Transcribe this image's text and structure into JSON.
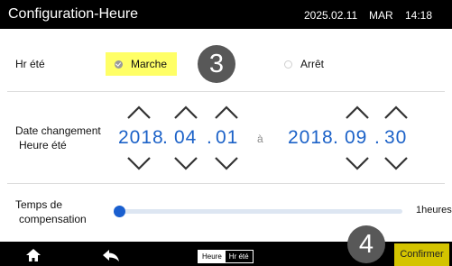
{
  "header": {
    "title": "Configuration-Heure",
    "date": "2025.02.11",
    "day": "MAR",
    "time": "14:18"
  },
  "dst_row": {
    "label": "Hr été",
    "option_on": "Marche",
    "option_off": "Arrêt",
    "selected": "Marche"
  },
  "step_badges": {
    "first": "3",
    "second": "4"
  },
  "change_date": {
    "label_line1": "Date changement",
    "label_line2": "Heure été",
    "start": {
      "year": "2018",
      "month": "04",
      "day": "01"
    },
    "separator_word": "à",
    "end": {
      "year": "2018",
      "month": "09",
      "day": "30"
    },
    "dot": "."
  },
  "compensation": {
    "label_line1": "Temps de",
    "label_line2": "compensation",
    "value_text": "1heures",
    "value": 1
  },
  "footer": {
    "toggle_left": "Heure",
    "toggle_right": "Hr été",
    "confirm": "Confirmer"
  },
  "colors": {
    "accent_blue": "#1c62c8",
    "highlight_yellow": "#ffff66",
    "confirm_yellow": "#d4c400"
  }
}
